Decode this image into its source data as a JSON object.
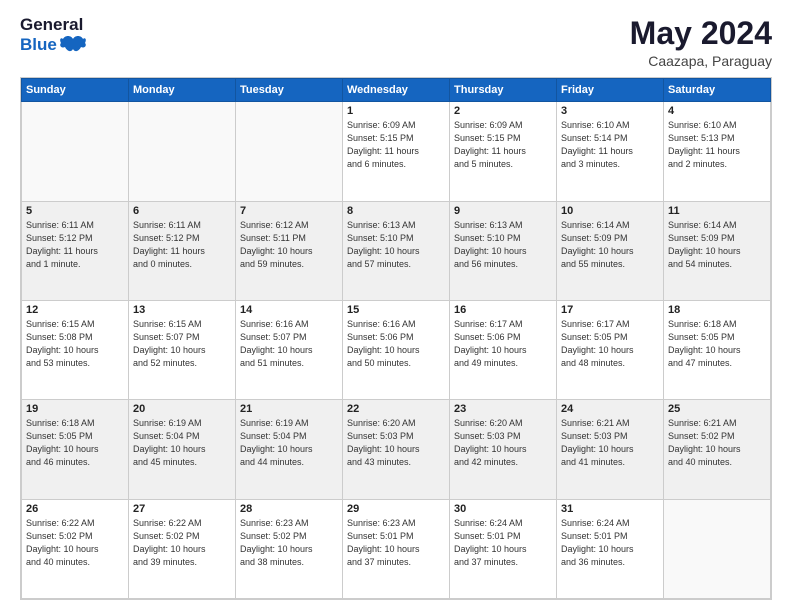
{
  "header": {
    "logo_general": "General",
    "logo_blue": "Blue",
    "month_title": "May 2024",
    "subtitle": "Caazapa, Paraguay"
  },
  "days_of_week": [
    "Sunday",
    "Monday",
    "Tuesday",
    "Wednesday",
    "Thursday",
    "Friday",
    "Saturday"
  ],
  "weeks": [
    [
      {
        "day": "",
        "info": ""
      },
      {
        "day": "",
        "info": ""
      },
      {
        "day": "",
        "info": ""
      },
      {
        "day": "1",
        "info": "Sunrise: 6:09 AM\nSunset: 5:15 PM\nDaylight: 11 hours\nand 6 minutes."
      },
      {
        "day": "2",
        "info": "Sunrise: 6:09 AM\nSunset: 5:15 PM\nDaylight: 11 hours\nand 5 minutes."
      },
      {
        "day": "3",
        "info": "Sunrise: 6:10 AM\nSunset: 5:14 PM\nDaylight: 11 hours\nand 3 minutes."
      },
      {
        "day": "4",
        "info": "Sunrise: 6:10 AM\nSunset: 5:13 PM\nDaylight: 11 hours\nand 2 minutes."
      }
    ],
    [
      {
        "day": "5",
        "info": "Sunrise: 6:11 AM\nSunset: 5:12 PM\nDaylight: 11 hours\nand 1 minute."
      },
      {
        "day": "6",
        "info": "Sunrise: 6:11 AM\nSunset: 5:12 PM\nDaylight: 11 hours\nand 0 minutes."
      },
      {
        "day": "7",
        "info": "Sunrise: 6:12 AM\nSunset: 5:11 PM\nDaylight: 10 hours\nand 59 minutes."
      },
      {
        "day": "8",
        "info": "Sunrise: 6:13 AM\nSunset: 5:10 PM\nDaylight: 10 hours\nand 57 minutes."
      },
      {
        "day": "9",
        "info": "Sunrise: 6:13 AM\nSunset: 5:10 PM\nDaylight: 10 hours\nand 56 minutes."
      },
      {
        "day": "10",
        "info": "Sunrise: 6:14 AM\nSunset: 5:09 PM\nDaylight: 10 hours\nand 55 minutes."
      },
      {
        "day": "11",
        "info": "Sunrise: 6:14 AM\nSunset: 5:09 PM\nDaylight: 10 hours\nand 54 minutes."
      }
    ],
    [
      {
        "day": "12",
        "info": "Sunrise: 6:15 AM\nSunset: 5:08 PM\nDaylight: 10 hours\nand 53 minutes."
      },
      {
        "day": "13",
        "info": "Sunrise: 6:15 AM\nSunset: 5:07 PM\nDaylight: 10 hours\nand 52 minutes."
      },
      {
        "day": "14",
        "info": "Sunrise: 6:16 AM\nSunset: 5:07 PM\nDaylight: 10 hours\nand 51 minutes."
      },
      {
        "day": "15",
        "info": "Sunrise: 6:16 AM\nSunset: 5:06 PM\nDaylight: 10 hours\nand 50 minutes."
      },
      {
        "day": "16",
        "info": "Sunrise: 6:17 AM\nSunset: 5:06 PM\nDaylight: 10 hours\nand 49 minutes."
      },
      {
        "day": "17",
        "info": "Sunrise: 6:17 AM\nSunset: 5:05 PM\nDaylight: 10 hours\nand 48 minutes."
      },
      {
        "day": "18",
        "info": "Sunrise: 6:18 AM\nSunset: 5:05 PM\nDaylight: 10 hours\nand 47 minutes."
      }
    ],
    [
      {
        "day": "19",
        "info": "Sunrise: 6:18 AM\nSunset: 5:05 PM\nDaylight: 10 hours\nand 46 minutes."
      },
      {
        "day": "20",
        "info": "Sunrise: 6:19 AM\nSunset: 5:04 PM\nDaylight: 10 hours\nand 45 minutes."
      },
      {
        "day": "21",
        "info": "Sunrise: 6:19 AM\nSunset: 5:04 PM\nDaylight: 10 hours\nand 44 minutes."
      },
      {
        "day": "22",
        "info": "Sunrise: 6:20 AM\nSunset: 5:03 PM\nDaylight: 10 hours\nand 43 minutes."
      },
      {
        "day": "23",
        "info": "Sunrise: 6:20 AM\nSunset: 5:03 PM\nDaylight: 10 hours\nand 42 minutes."
      },
      {
        "day": "24",
        "info": "Sunrise: 6:21 AM\nSunset: 5:03 PM\nDaylight: 10 hours\nand 41 minutes."
      },
      {
        "day": "25",
        "info": "Sunrise: 6:21 AM\nSunset: 5:02 PM\nDaylight: 10 hours\nand 40 minutes."
      }
    ],
    [
      {
        "day": "26",
        "info": "Sunrise: 6:22 AM\nSunset: 5:02 PM\nDaylight: 10 hours\nand 40 minutes."
      },
      {
        "day": "27",
        "info": "Sunrise: 6:22 AM\nSunset: 5:02 PM\nDaylight: 10 hours\nand 39 minutes."
      },
      {
        "day": "28",
        "info": "Sunrise: 6:23 AM\nSunset: 5:02 PM\nDaylight: 10 hours\nand 38 minutes."
      },
      {
        "day": "29",
        "info": "Sunrise: 6:23 AM\nSunset: 5:01 PM\nDaylight: 10 hours\nand 37 minutes."
      },
      {
        "day": "30",
        "info": "Sunrise: 6:24 AM\nSunset: 5:01 PM\nDaylight: 10 hours\nand 37 minutes."
      },
      {
        "day": "31",
        "info": "Sunrise: 6:24 AM\nSunset: 5:01 PM\nDaylight: 10 hours\nand 36 minutes."
      },
      {
        "day": "",
        "info": ""
      }
    ]
  ]
}
